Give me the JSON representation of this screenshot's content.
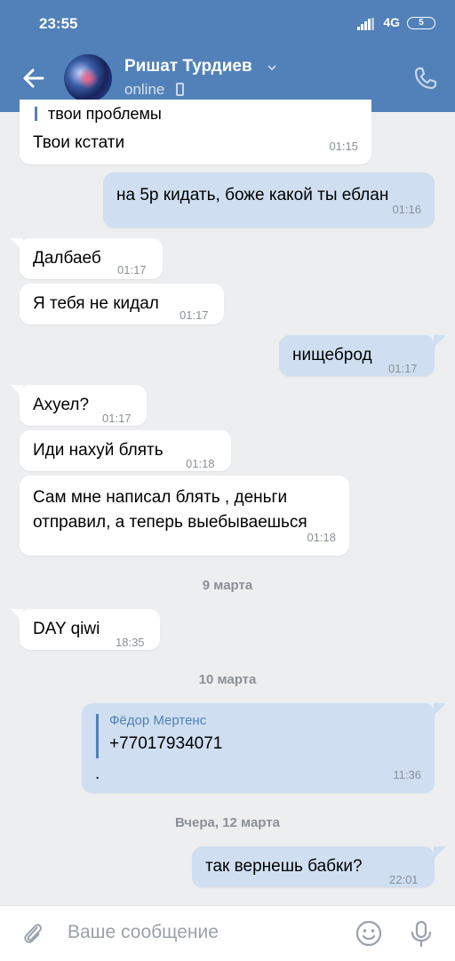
{
  "status_bar": {
    "time": "23:55",
    "network": "4G",
    "battery": "5"
  },
  "header": {
    "contact_name": "Ришат Турдиев",
    "presence": "online"
  },
  "messages": [
    {
      "dir": "in",
      "quote": "твои проблемы",
      "text": "Твои кстати",
      "time": "01:15"
    },
    {
      "dir": "out",
      "text": "на 5р кидать, боже какой ты еблан",
      "time": "01:16"
    },
    {
      "dir": "in",
      "text": "Далбаеб",
      "time": "01:17"
    },
    {
      "dir": "in",
      "text": "Я тебя не кидал",
      "time": "01:17"
    },
    {
      "dir": "out",
      "text": "нищеброд",
      "time": "01:17"
    },
    {
      "dir": "in",
      "text": "Ахуел?",
      "time": "01:17"
    },
    {
      "dir": "in",
      "text": "Иди нахуй блять",
      "time": "01:18"
    },
    {
      "dir": "in",
      "text_line1": "Сам мне написал блять , деньги",
      "text_line2": "отправил, а теперь выебываешься",
      "time": "01:18"
    },
    {
      "dir": "in",
      "text": "DAY qiwi",
      "time": "18:35"
    },
    {
      "dir": "out",
      "forward_from": "Фёдор Мертенс",
      "forward_text": "+77017934071",
      "text": ".",
      "time": "11:36"
    },
    {
      "dir": "out",
      "text": "так вернешь бабки?",
      "time": "22:01"
    }
  ],
  "date_separators": [
    "9 марта",
    "10 марта",
    "Вчера, 12 марта"
  ],
  "composer": {
    "placeholder": "Ваше сообщение"
  },
  "icons": {
    "back": "arrow-left-icon",
    "call": "phone-icon",
    "attach": "paperclip-icon",
    "emoji": "smile-icon",
    "mic": "microphone-icon"
  },
  "colors": {
    "header": "#5181b8",
    "outgoing_bubble": "#cfdff1",
    "background": "#edeef0"
  }
}
